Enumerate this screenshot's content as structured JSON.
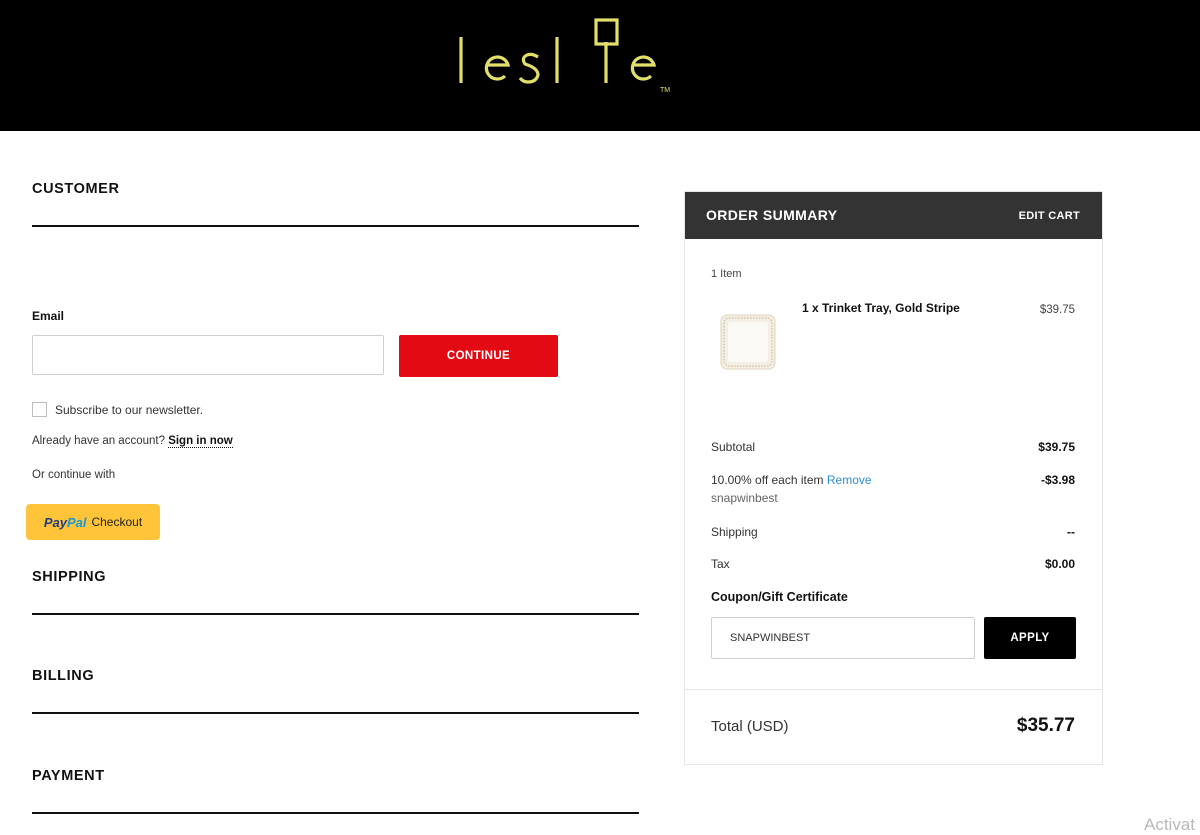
{
  "brand": {
    "logo_text": "leslie",
    "trademark": "TM"
  },
  "customer": {
    "title": "CUSTOMER",
    "email_label": "Email",
    "email_value": "",
    "continue_label": "CONTINUE",
    "newsletter_label": "Subscribe to our newsletter.",
    "account_prompt": "Already have an account?",
    "sign_in_label": "Sign in now",
    "or_continue": "Or continue with",
    "paypal": {
      "pay": "Pay",
      "pal": "Pal",
      "checkout": "Checkout"
    }
  },
  "sections": {
    "shipping": "SHIPPING",
    "billing": "BILLING",
    "payment": "PAYMENT"
  },
  "order_summary": {
    "title": "ORDER SUMMARY",
    "edit_cart": "EDIT CART",
    "item_count": "1 Item",
    "item": {
      "name": "1 x Trinket Tray, Gold Stripe",
      "price": "$39.75",
      "icon": "trinket-tray-thumbnail"
    },
    "subtotal_label": "Subtotal",
    "subtotal_value": "$39.75",
    "discount_label": "10.00% off each item",
    "remove_label": "Remove",
    "discount_value": "-$3.98",
    "coupon_code": "snapwinbest",
    "shipping_label": "Shipping",
    "shipping_value": "--",
    "tax_label": "Tax",
    "tax_value": "$0.00",
    "coupon_title": "Coupon/Gift Certificate",
    "coupon_input_value": "SNAPWINBEST",
    "apply_label": "APPLY",
    "total_label": "Total (USD)",
    "total_value": "$35.77"
  },
  "watermark": "Activat",
  "colors": {
    "continue": "#e30b13",
    "paypal": "#ffc439",
    "logo": "#e3e06a",
    "summary_header": "#333333"
  }
}
